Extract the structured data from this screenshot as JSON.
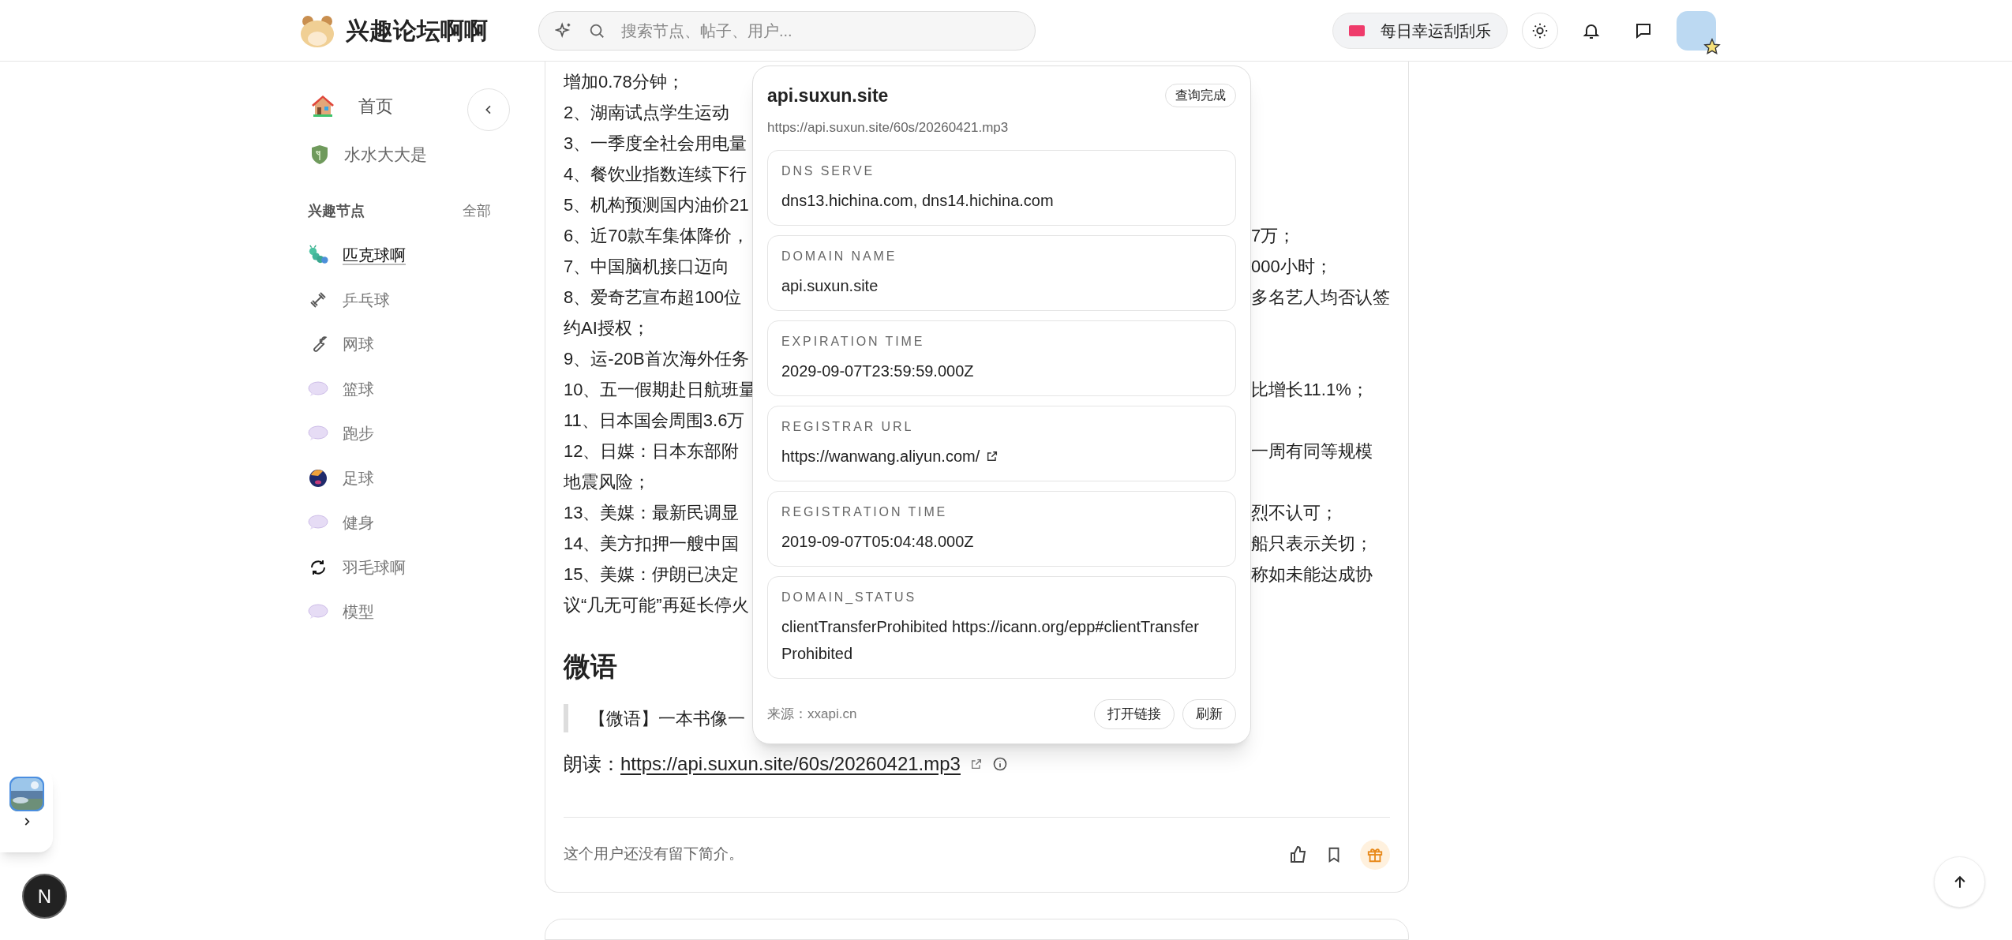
{
  "header": {
    "site_name": "兴趣论坛啊啊",
    "search": {
      "placeholder": "搜索节点、帖子、用户..."
    },
    "lottery_button": "每日幸运刮刮乐"
  },
  "sidebar": {
    "nav": [
      {
        "label": "首页"
      },
      {
        "label": "水水大大是"
      }
    ],
    "section_title": "兴趣节点",
    "section_link": "全部",
    "nodes": [
      {
        "label": "匹克球啊",
        "selected": true
      },
      {
        "label": "乒乓球",
        "selected": false
      },
      {
        "label": "网球",
        "selected": false
      },
      {
        "label": "篮球",
        "selected": false
      },
      {
        "label": "跑步",
        "selected": false
      },
      {
        "label": "足球",
        "selected": false
      },
      {
        "label": "健身",
        "selected": false
      },
      {
        "label": "羽毛球啊",
        "selected": false
      },
      {
        "label": "模型",
        "selected": false
      }
    ]
  },
  "article": {
    "lines": [
      {
        "left": "增加0.78分钟；"
      },
      {
        "left": "2、湖南试点学生运动"
      },
      {
        "left": "3、一季度全社会用电量"
      },
      {
        "left": "4、餐饮业指数连续下行"
      },
      {
        "left": "5、机构预测国内油价21"
      },
      {
        "left": "6、近70款车集体降价，",
        "right": "7万；"
      },
      {
        "left": "7、中国脑机接口迈向",
        "right": "000小时；"
      },
      {
        "left": "8、爱奇艺宣布超100位",
        "right": "多名艺人均否认签"
      },
      {
        "left": "约AI授权；"
      },
      {
        "left": "9、运-20B首次海外任务"
      },
      {
        "left": "10、五一假期赴日航班量",
        "right": "比增长11.1%；"
      },
      {
        "left": "11、日本国会周围3.6万"
      },
      {
        "left": "12、日媒：日本东部附",
        "right": "一周有同等规模"
      },
      {
        "left": "地震风险；"
      },
      {
        "left": "13、美媒：最新民调显",
        "right": "烈不认可；"
      },
      {
        "left": "14、美方扣押一艘中国",
        "right": "船只表示关切；"
      },
      {
        "left": "15、美媒：伊朗已决定",
        "right": "称如未能达成协"
      },
      {
        "left": "议“几无可能”再延长停火"
      }
    ],
    "heading": "微语",
    "quote": "【微语】一本书像一",
    "read_label": "朗读：",
    "read_link": "https://api.suxun.site/60s/20260421.mp3",
    "author_bio": "这个用户还没有留下简介。"
  },
  "popup": {
    "title": "api.suxun.site",
    "status": "查询完成",
    "url": "https://api.suxun.site/60s/20260421.mp3",
    "fields": [
      {
        "label": "DNS SERVE",
        "value": "dns13.hichina.com, dns14.hichina.com",
        "external": false
      },
      {
        "label": "DOMAIN NAME",
        "value": "api.suxun.site",
        "external": false
      },
      {
        "label": "EXPIRATION TIME",
        "value": "2029-09-07T23:59:59.000Z",
        "external": false
      },
      {
        "label": "REGISTRAR URL",
        "value": "https://wanwang.aliyun.com/",
        "external": true
      },
      {
        "label": "REGISTRATION TIME",
        "value": "2019-09-07T05:04:48.000Z",
        "external": false
      },
      {
        "label": "DOMAIN_STATUS",
        "value": "clientTransferProhibited https://icann.org/epp#clientTransferProhibited",
        "external": false
      }
    ],
    "source": "来源：xxapi.cn",
    "buttons": [
      "打开链接",
      "刷新"
    ]
  },
  "floating": {
    "avatar_letter": "N"
  }
}
